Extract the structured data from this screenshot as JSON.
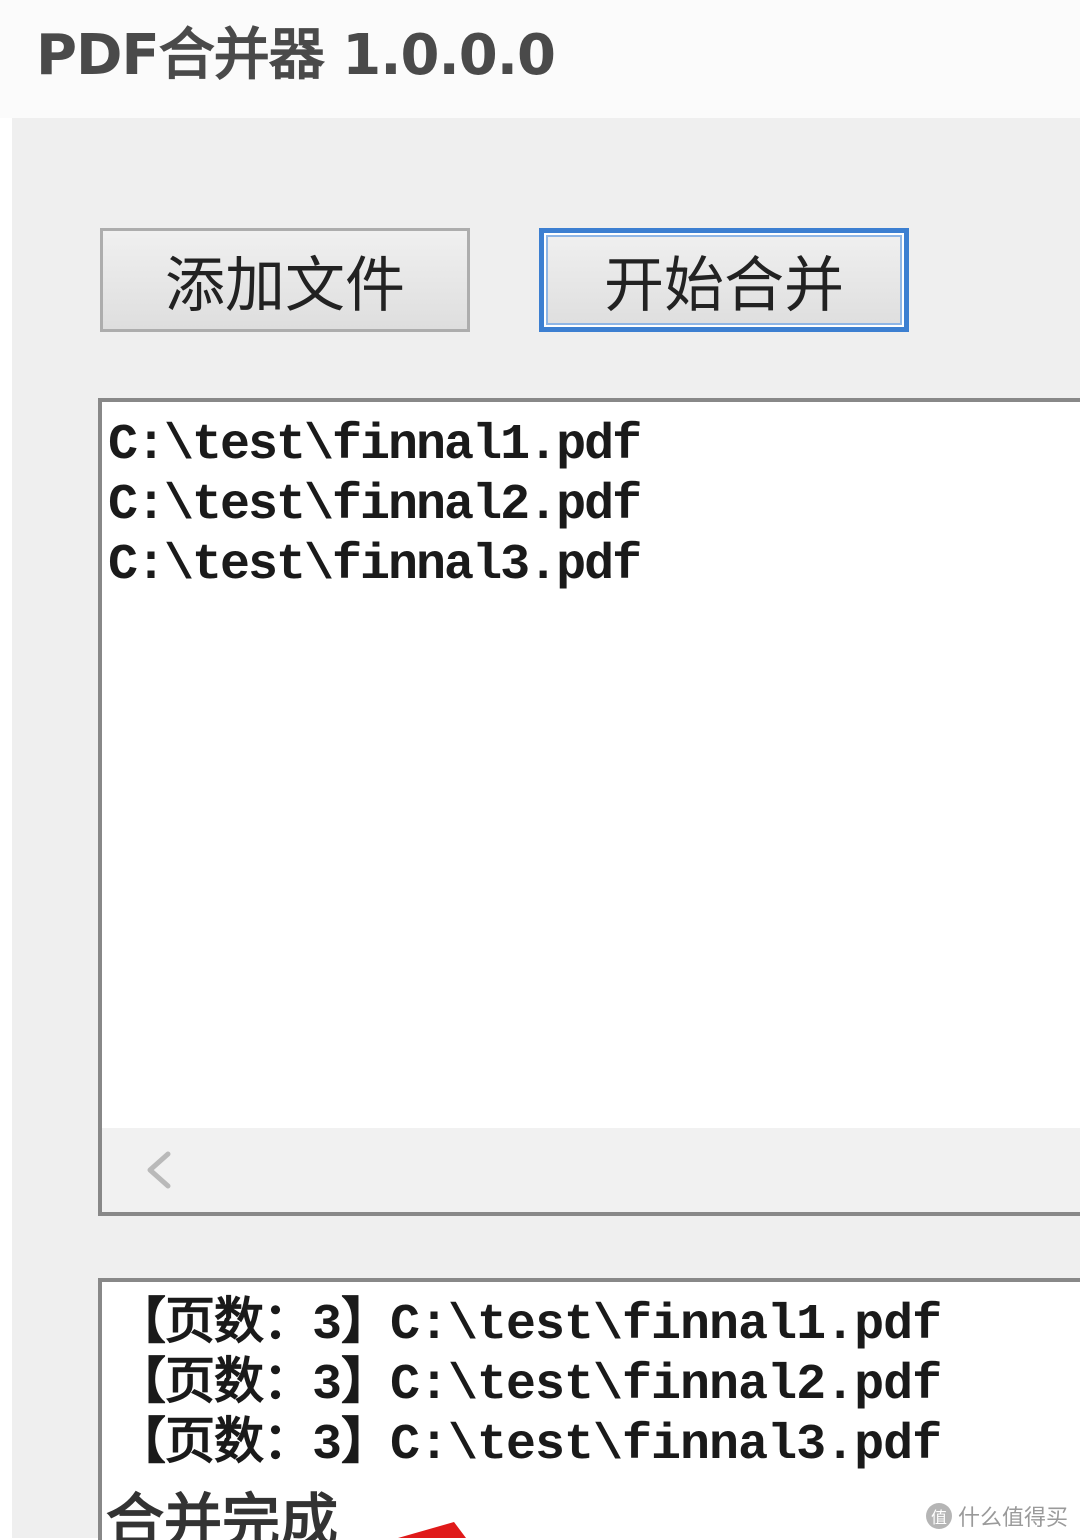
{
  "window": {
    "title": "PDF合并器 1.0.0.0"
  },
  "toolbar": {
    "add_files_label": "添加文件",
    "start_merge_label": "开始合并"
  },
  "file_list": {
    "items": [
      "C:\\test\\finnal1.pdf",
      "C:\\test\\finnal2.pdf",
      "C:\\test\\finnal3.pdf"
    ],
    "scroll_icon": "chevron-left-icon"
  },
  "log": {
    "lines": [
      "【页数：3】C:\\test\\finnal1.pdf",
      "【页数：3】C:\\test\\finnal2.pdf",
      "【页数：3】C:\\test\\finnal3.pdf"
    ],
    "status": "合并完成"
  },
  "watermark": {
    "logo_text": "值",
    "text": "什么值得买"
  },
  "colors": {
    "focus_border": "#3c7fd1",
    "annotation_red": "#e01a1a"
  }
}
